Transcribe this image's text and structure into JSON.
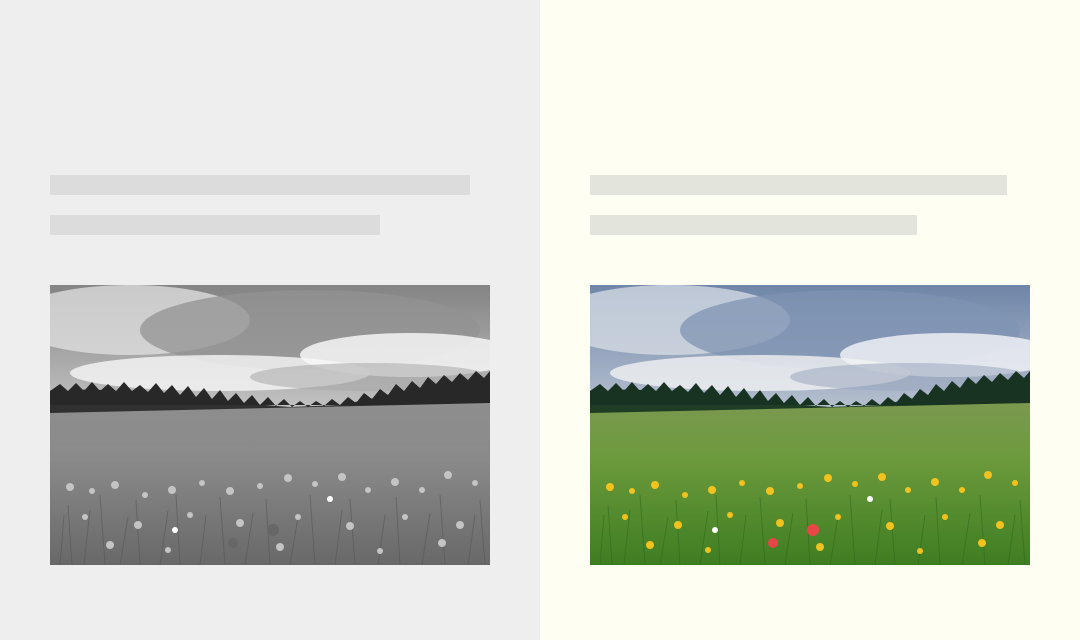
{
  "layout_preview": {
    "variant_left": {
      "theme": "grayscale",
      "background_color": "#eeeeee",
      "skeleton_color": "#dcdcdc",
      "image": "meadow-landscape"
    },
    "variant_right": {
      "theme": "color",
      "background_color": "#fefff2",
      "skeleton_color": "#e3e4dc",
      "image": "meadow-landscape"
    }
  }
}
